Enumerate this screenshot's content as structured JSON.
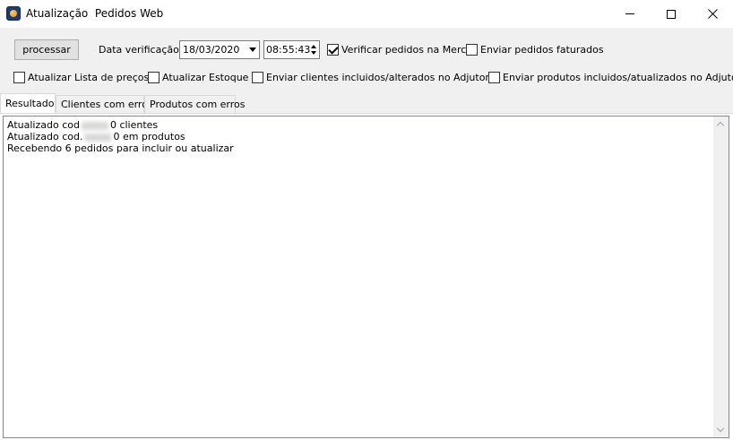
{
  "window": {
    "title": "Atualização  Pedidos Web"
  },
  "toolbar": {
    "process_button": "processar",
    "date_label": "Data verificação:",
    "date_value": "18/03/2020",
    "time_value": "08:55:43",
    "checkboxes": [
      {
        "label": "Verificar pedidos na Mercos",
        "checked": true
      },
      {
        "label": "Enviar pedidos faturados",
        "checked": false
      },
      {
        "label": "Atualizar Lista de preços",
        "checked": false
      },
      {
        "label": "Atualizar Estoque",
        "checked": false
      },
      {
        "label": "Enviar clientes incluidos/alterados no Adjutor",
        "checked": false
      },
      {
        "label": "Enviar produtos incluidos/atualizados no Adjutor",
        "checked": false
      }
    ]
  },
  "tabs": [
    {
      "label": "Resultado",
      "active": true
    },
    {
      "label": "Clientes com erros",
      "active": false
    },
    {
      "label": "Produtos com erros",
      "active": false
    }
  ],
  "result_log": {
    "lines": [
      {
        "prefix": "Atualizado cod",
        "suffix": "0 clientes"
      },
      {
        "prefix": "Atualizado cod.",
        "suffix": "0 em produtos"
      },
      {
        "prefix": "Recebendo 6 pedidos para incluir ou atualizar",
        "suffix": ""
      }
    ]
  }
}
